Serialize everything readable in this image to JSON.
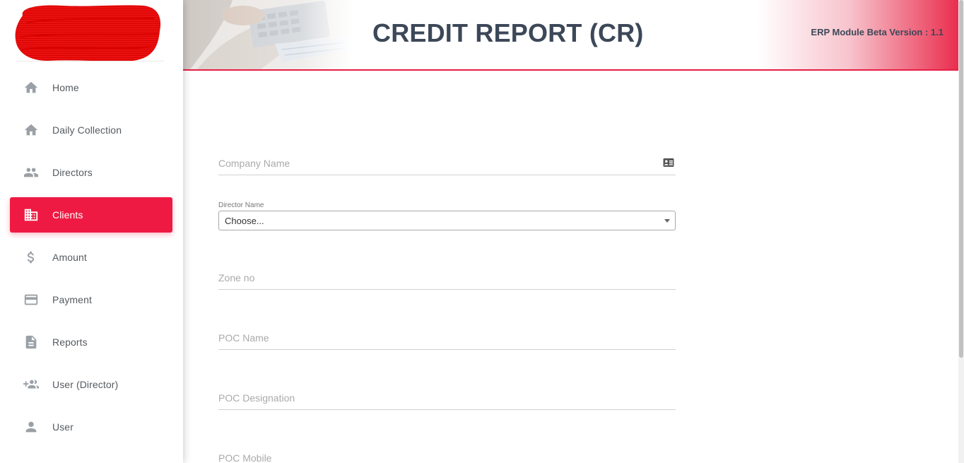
{
  "header": {
    "title": "CREDIT REPORT (CR)",
    "version": "ERP Module Beta Version : 1.1"
  },
  "sidebar": {
    "items": [
      {
        "label": "Home",
        "icon": "home-icon"
      },
      {
        "label": "Daily Collection",
        "icon": "home-icon"
      },
      {
        "label": "Directors",
        "icon": "people-icon"
      },
      {
        "label": "Clients",
        "icon": "building-icon",
        "active": true
      },
      {
        "label": "Amount",
        "icon": "dollar-icon"
      },
      {
        "label": "Payment",
        "icon": "credit-card-icon"
      },
      {
        "label": "Reports",
        "icon": "document-icon"
      },
      {
        "label": "User (Director)",
        "icon": "group-add-icon"
      },
      {
        "label": "User",
        "icon": "person-icon"
      }
    ]
  },
  "form": {
    "company_name": {
      "placeholder": "Company Name",
      "icon": "contact-card-icon"
    },
    "director_name": {
      "label": "Director Name",
      "selected": "Choose..."
    },
    "zone_no": {
      "placeholder": "Zone no"
    },
    "poc_name": {
      "placeholder": "POC Name"
    },
    "poc_designation": {
      "placeholder": "POC Designation"
    },
    "poc_mobile": {
      "placeholder": "POC Mobile"
    }
  },
  "colors": {
    "accent": "#ef1a43",
    "title_text": "#3c4858",
    "sidebar_icon": "#9aa0a6"
  }
}
